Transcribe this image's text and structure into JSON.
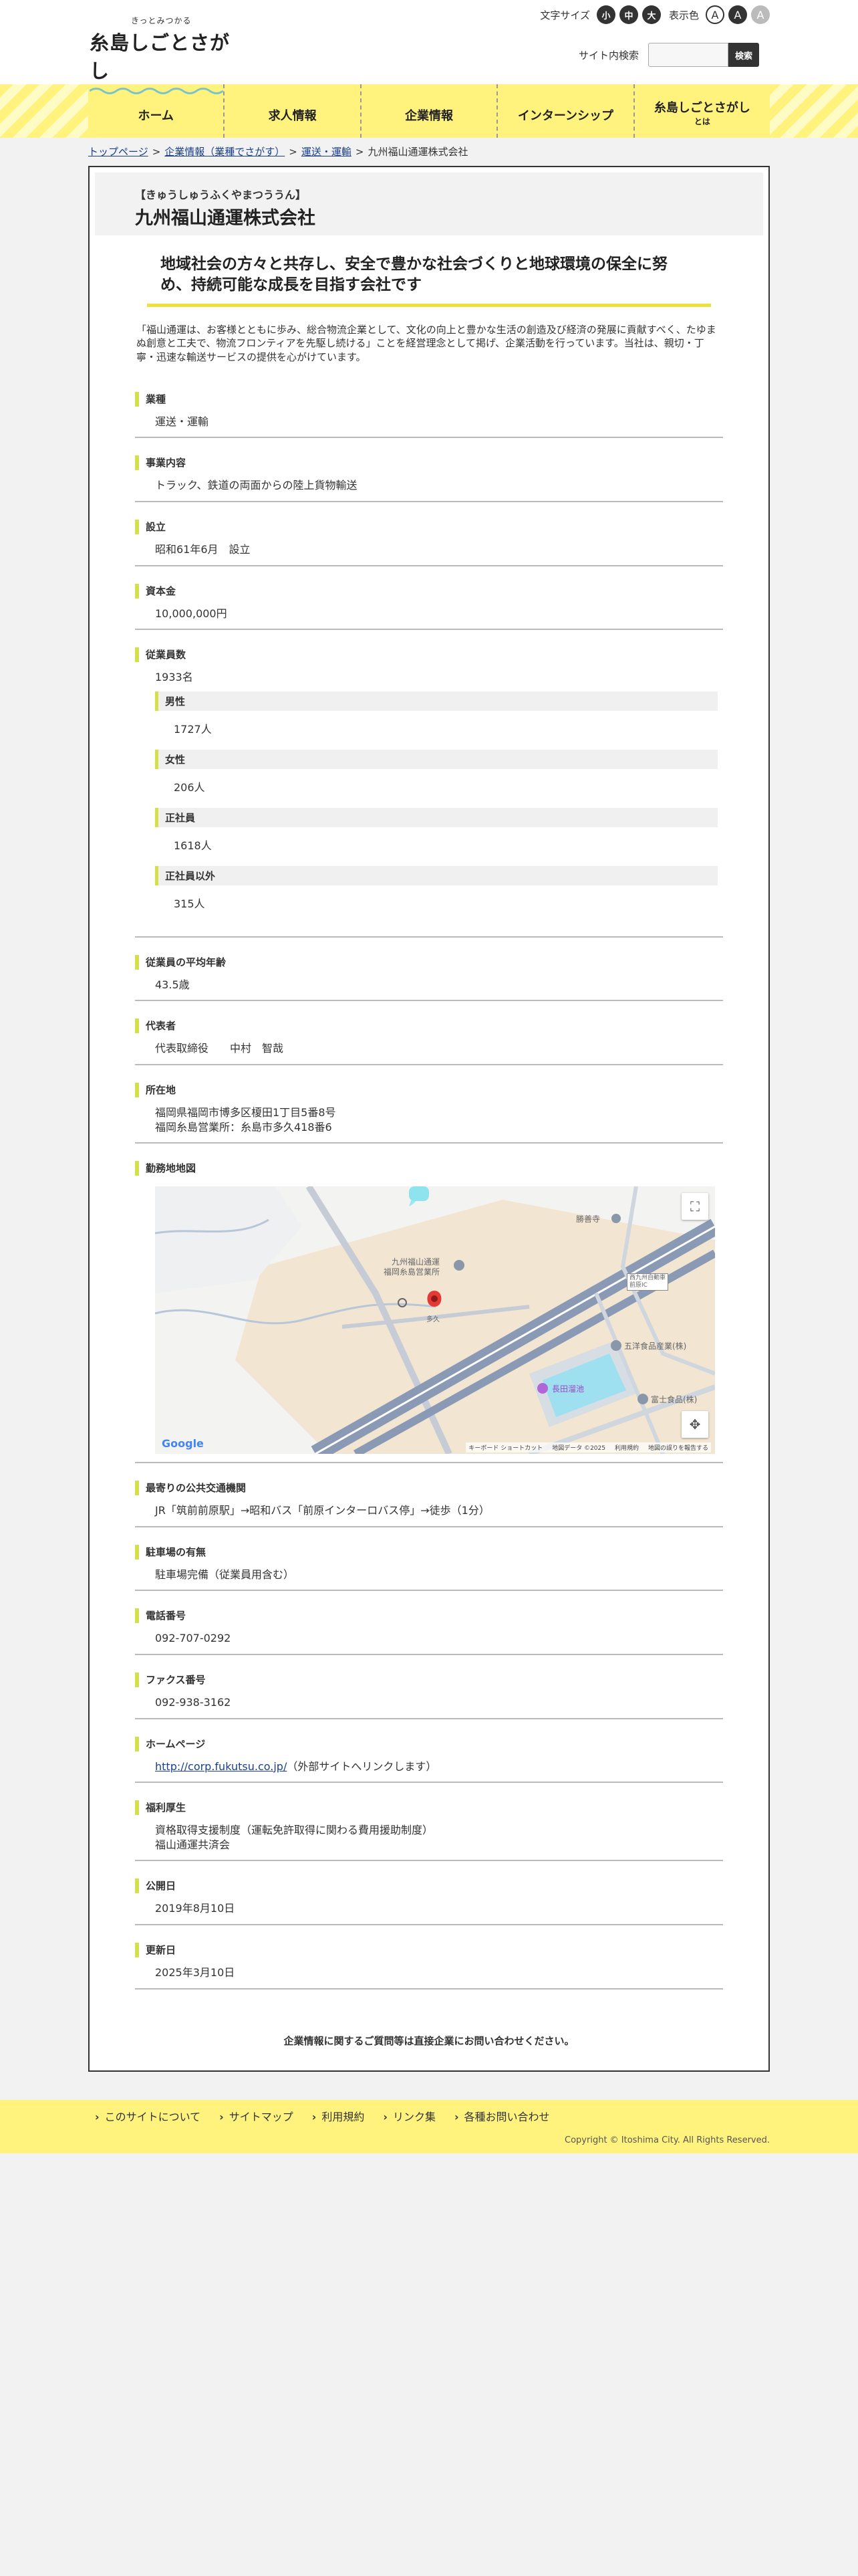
{
  "site": {
    "logo_sub": "きっとみつかる",
    "logo_main": "糸島しごとさがし",
    "font_size_label": "文字サイズ",
    "font_sizes": [
      "小",
      "中",
      "大"
    ],
    "color_label": "表示色",
    "colors": [
      "A",
      "A",
      "A"
    ],
    "search_label": "サイト内検索",
    "search_button": "検索"
  },
  "nav": {
    "items": [
      "ホーム",
      "求人情報",
      "企業情報",
      "インターンシップ",
      "糸島しごとさがし"
    ],
    "last_sub": "とは"
  },
  "breadcrumb": {
    "items": [
      "トップページ",
      "企業情報（業種でさがす）",
      "運送・運輸",
      "九州福山通運株式会社"
    ],
    "sep": ">"
  },
  "company": {
    "kana": "【きゅうしゅうふくやまつううん】",
    "name": "九州福山通運株式会社",
    "lead": "地域社会の方々と共存し、安全で豊かな社会づくりと地球環境の保全に努め、持続可能な成長を目指す会社です",
    "intro": "「福山通運は、お客様とともに歩み、総合物流企業として、文化の向上と豊かな生活の創造及び経済の発展に貢献すべく、たゆまぬ創意と工夫で、物流フロンティアを先駆し続ける」ことを経営理念として掲げ、企業活動を行っています。当社は、親切・丁寧・迅速な輸送サービスの提供を心がけています。"
  },
  "details": {
    "industry": {
      "title": "業種",
      "value": "運送・運輸"
    },
    "business": {
      "title": "事業内容",
      "value": "トラック、鉄道の両面からの陸上貨物輸送"
    },
    "founded": {
      "title": "設立",
      "value": "昭和61年6月　設立"
    },
    "capital": {
      "title": "資本金",
      "value": "10,000,000円"
    },
    "employees": {
      "title": "従業員数",
      "value": "1933名",
      "male_title": "男性",
      "male_value": "1727人",
      "female_title": "女性",
      "female_value": "206人",
      "regular_title": "正社員",
      "regular_value": "1618人",
      "nonregular_title": "正社員以外",
      "nonregular_value": "315人"
    },
    "avg_age": {
      "title": "従業員の平均年齢",
      "value": "43.5歳"
    },
    "representative": {
      "title": "代表者",
      "value": "代表取締役　　中村　智哉"
    },
    "address": {
      "title": "所在地",
      "line1": "福岡県福岡市博多区榎田1丁目5番8号",
      "line2": "福岡糸島営業所：糸島市多久418番6"
    },
    "map": {
      "title": "勤務地地図",
      "label_company": "九州福山通運\n福岡糸島営業所",
      "label_temple": "勝善寺",
      "label_pin": "多久",
      "label_box": "西九州自動車\n前原IC",
      "label_food1": "五洋食品産業(株)",
      "label_food2": "富士食品(株)",
      "label_pond": "長田溜池",
      "google": "Google",
      "foot": [
        "キーボード ショートカット",
        "地図データ ©2025",
        "利用規約",
        "地図の誤りを報告する"
      ]
    },
    "transport": {
      "title": "最寄りの公共交通機関",
      "value": "JR「筑前前原駅」→昭和バス「前原インターロバス停」→徒歩（1分）"
    },
    "parking": {
      "title": "駐車場の有無",
      "value": "駐車場完備（従業員用含む）"
    },
    "phone": {
      "title": "電話番号",
      "value": "092-707-0292"
    },
    "fax": {
      "title": "ファクス番号",
      "value": "092-938-3162"
    },
    "homepage": {
      "title": "ホームページ",
      "url": "http://corp.fukutsu.co.jp/",
      "note": "（外部サイトへリンクします）"
    },
    "welfare": {
      "title": "福利厚生",
      "line1": "資格取得支援制度（運転免許取得に関わる費用援助制度）",
      "line2": "福山通運共済会"
    },
    "published": {
      "title": "公開日",
      "value": "2019年8月10日"
    },
    "updated": {
      "title": "更新日",
      "value": "2025年3月10日"
    }
  },
  "contact_note": "企業情報に関するご質問等は直接企業にお問い合わせください。",
  "footer": {
    "links": [
      "このサイトについて",
      "サイトマップ",
      "利用規約",
      "リンク集",
      "各種お問い合わせ"
    ],
    "copyright": "Copyright © Itoshima City. All Rights Reserved."
  }
}
